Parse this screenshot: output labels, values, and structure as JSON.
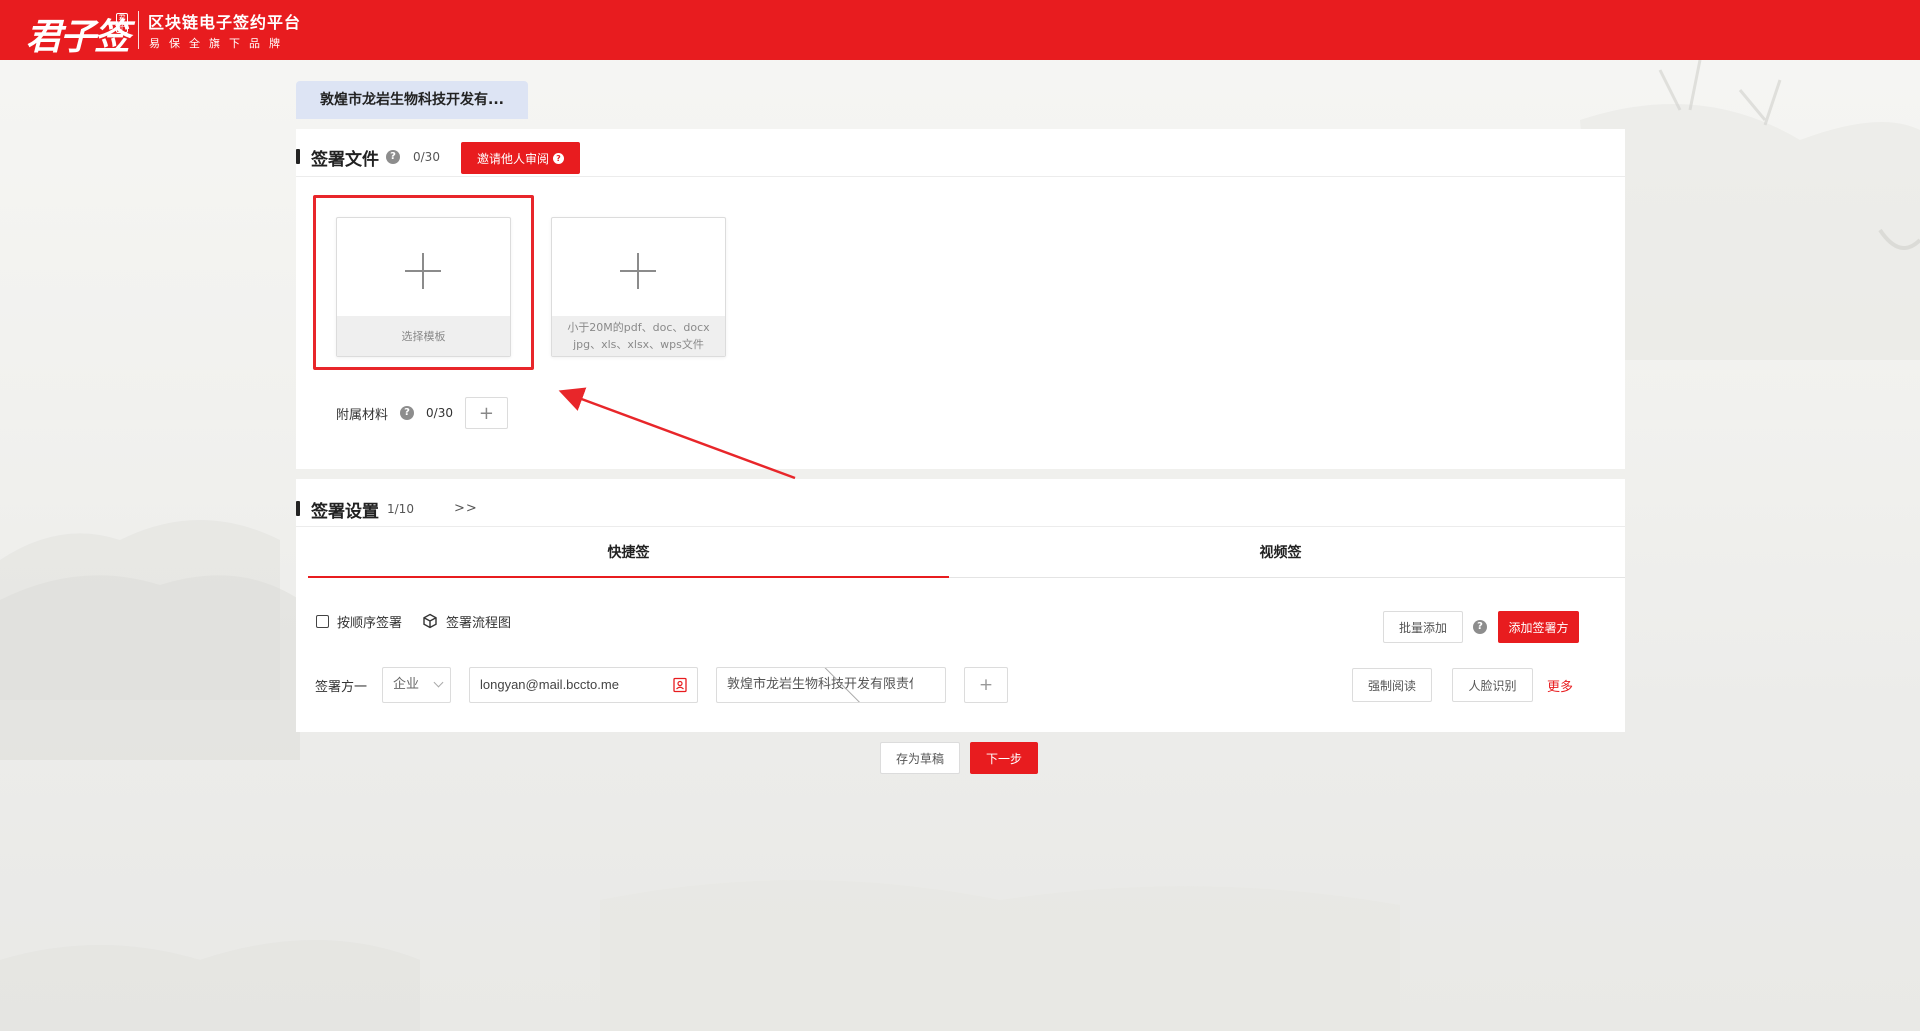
{
  "header": {
    "logo_text": "君子签",
    "logo_seal": "君子",
    "tagline": "区块链电子签约平台",
    "subtagline": "易保全旗下品牌"
  },
  "company_tab": {
    "label": "敦煌市龙岩生物科技开发有..."
  },
  "files_section": {
    "title": "签署文件",
    "count": "0/30",
    "invite_button": "邀请他人审阅",
    "template_card_caption": "选择模板",
    "upload_card_caption_line1": "小于20M的pdf、doc、docx",
    "upload_card_caption_line2": "jpg、xls、xlsx、wps文件",
    "attachments_label": "附属材料",
    "attachments_count": "0/30",
    "attachments_add": "+"
  },
  "settings_section": {
    "title": "签署设置",
    "count": "1/10",
    "expand": ">>",
    "tabs": [
      {
        "label": "快捷签",
        "active": true
      },
      {
        "label": "视频签",
        "active": false
      }
    ],
    "sequential_label": "按顺序签署",
    "flow_chart_label": "签署流程图",
    "batch_add_button": "批量添加",
    "add_signer_button": "添加签署方",
    "signer": {
      "label": "签署方一",
      "type": "企业",
      "email": "longyan@mail.bccto.me",
      "company": "敦煌市龙岩生物科技开发有限责任",
      "add": "+",
      "force_read_button": "强制阅读",
      "face_recognition_button": "人脸识别",
      "more_link": "更多"
    }
  },
  "footer": {
    "save_draft_button": "存为草稿",
    "next_button": "下一步"
  },
  "colors": {
    "brand_red": "#e81c1f",
    "highlight_red": "#e8262a",
    "tab_bg": "#dde4f4"
  }
}
